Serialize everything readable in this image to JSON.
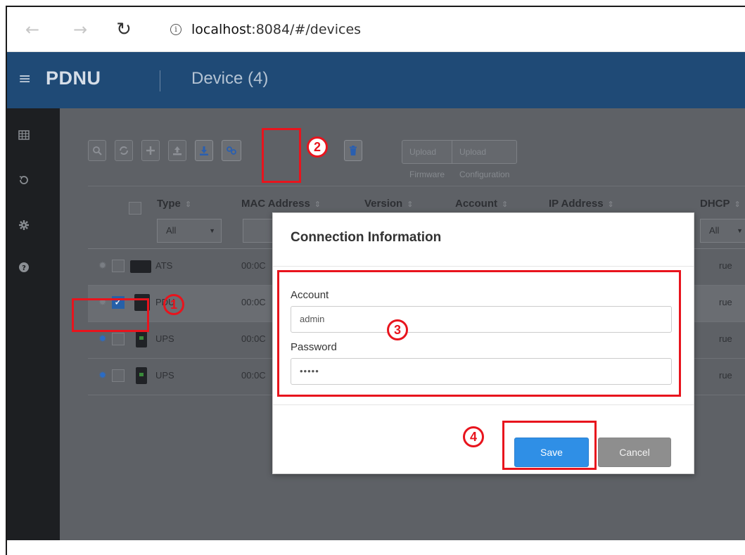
{
  "browser": {
    "back_glyph": "←",
    "forward_glyph": "→",
    "reload_glyph": "↻",
    "info_glyph": "i",
    "url_host": "localhost",
    "url_rest": ":8084/#/devices"
  },
  "header": {
    "menu_glyph": "≡",
    "logo": "PDNU",
    "title": "Device (4)"
  },
  "sidebar": {
    "icons": [
      "grid-icon",
      "history-icon",
      "settings-icon",
      "help-icon"
    ]
  },
  "toolbar": {
    "icons": [
      "search-icon",
      "refresh-icon",
      "add-icon",
      "upload-icon",
      "download-icon",
      "link-icon",
      "delete-icon"
    ],
    "upload_firmware": "Upload Firmware",
    "upload_configuration": "Upload Configuration"
  },
  "table": {
    "columns": {
      "type": "Type",
      "mac": "MAC Address",
      "version": "Version",
      "account": "Account",
      "ip": "IP Address",
      "dhcp": "DHCP"
    },
    "sort_glyph": "⇕",
    "type_filter": "All",
    "dhcp_filter": "All",
    "rows": [
      {
        "type": "ATS",
        "mac": "00:0C",
        "dhcp": "rue"
      },
      {
        "type": "PDU",
        "mac": "00:0C",
        "dhcp": "rue"
      },
      {
        "type": "UPS",
        "mac": "00:0C",
        "dhcp": "rue"
      },
      {
        "type": "UPS",
        "mac": "00:0C",
        "dhcp": "rue"
      }
    ]
  },
  "modal": {
    "title": "Connection Information",
    "account_label": "Account",
    "account_value": "admin",
    "password_label": "Password",
    "password_value": "•••••",
    "save": "Save",
    "cancel": "Cancel"
  },
  "annotations": {
    "step1": "1",
    "step2": "2",
    "step3": "3",
    "step4": "4",
    "color": "#e8141d"
  },
  "colors": {
    "header_bg": "#1f4a76",
    "sidebar_bg": "#1d1f22",
    "overlay_bg": "#5e6166",
    "save_bg": "#2f8fe6",
    "cancel_bg": "#8e8e8e"
  }
}
